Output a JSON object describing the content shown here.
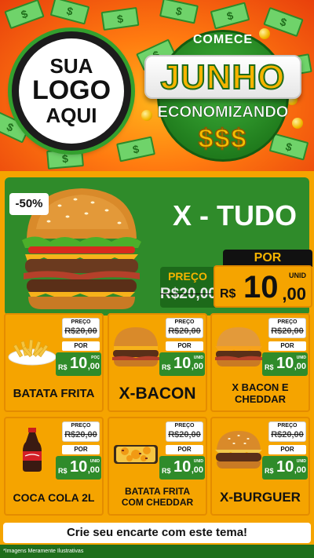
{
  "header": {
    "logo_placeholder": {
      "line1": "SUA",
      "line2": "LOGO",
      "line3": "AQUI"
    },
    "campaign": {
      "line1": "COMECE",
      "line2": "JUNHO",
      "line3": "ECONOMIZANDO",
      "symbols": "$$$"
    }
  },
  "featured": {
    "discount": "-50%",
    "name": "X - TUDO",
    "old_price_label": "PREÇO",
    "old_price": "R$20,00",
    "por_label": "POR",
    "currency": "R$",
    "price_int": "10",
    "price_cents": ",00",
    "unit": "UNID"
  },
  "products": [
    {
      "name": "BATATA FRITA",
      "image": "french-fries",
      "old_label": "PREÇO",
      "old_price": "R$20,00",
      "por": "POR",
      "currency": "R$",
      "price_int": "10",
      "price_cents": ",00",
      "unit": "POÇ"
    },
    {
      "name": "X-BACON",
      "image": "burger-bacon",
      "old_label": "PREÇO",
      "old_price": "R$20,00",
      "por": "POR",
      "currency": "R$",
      "price_int": "10",
      "price_cents": ",00",
      "unit": "UNID"
    },
    {
      "name": "X BACON E CHEDDAR",
      "image": "burger-cheddar",
      "old_label": "PREÇO",
      "old_price": "R$20,00",
      "por": "POR",
      "currency": "R$",
      "price_int": "10",
      "price_cents": ",00",
      "unit": "UNID"
    },
    {
      "name": "COCA COLA 2L",
      "image": "soda-bottle",
      "old_label": "PREÇO",
      "old_price": "R$20,00",
      "por": "POR",
      "currency": "R$",
      "price_int": "10",
      "price_cents": ",00",
      "unit": "UNID"
    },
    {
      "name": "BATATA FRITA COM CHEDDAR",
      "image": "fries-cheddar",
      "old_label": "PREÇO",
      "old_price": "R$20,00",
      "por": "POR",
      "currency": "R$",
      "price_int": "10",
      "price_cents": ",00",
      "unit": "UNID"
    },
    {
      "name": "X-BURGUER",
      "image": "burger-classic",
      "old_label": "PREÇO",
      "old_price": "R$20,00",
      "por": "POR",
      "currency": "R$",
      "price_int": "10",
      "price_cents": ",00",
      "unit": "UNID"
    }
  ],
  "footer": {
    "cta": "Crie seu encarte com este tema!",
    "disclaimer": "*Imagens Meramente Ilustrativas"
  },
  "colors": {
    "green": "#2f8b2a",
    "orange": "#f5a400",
    "header_red": "#e8400c",
    "gold": "#f6b400"
  }
}
